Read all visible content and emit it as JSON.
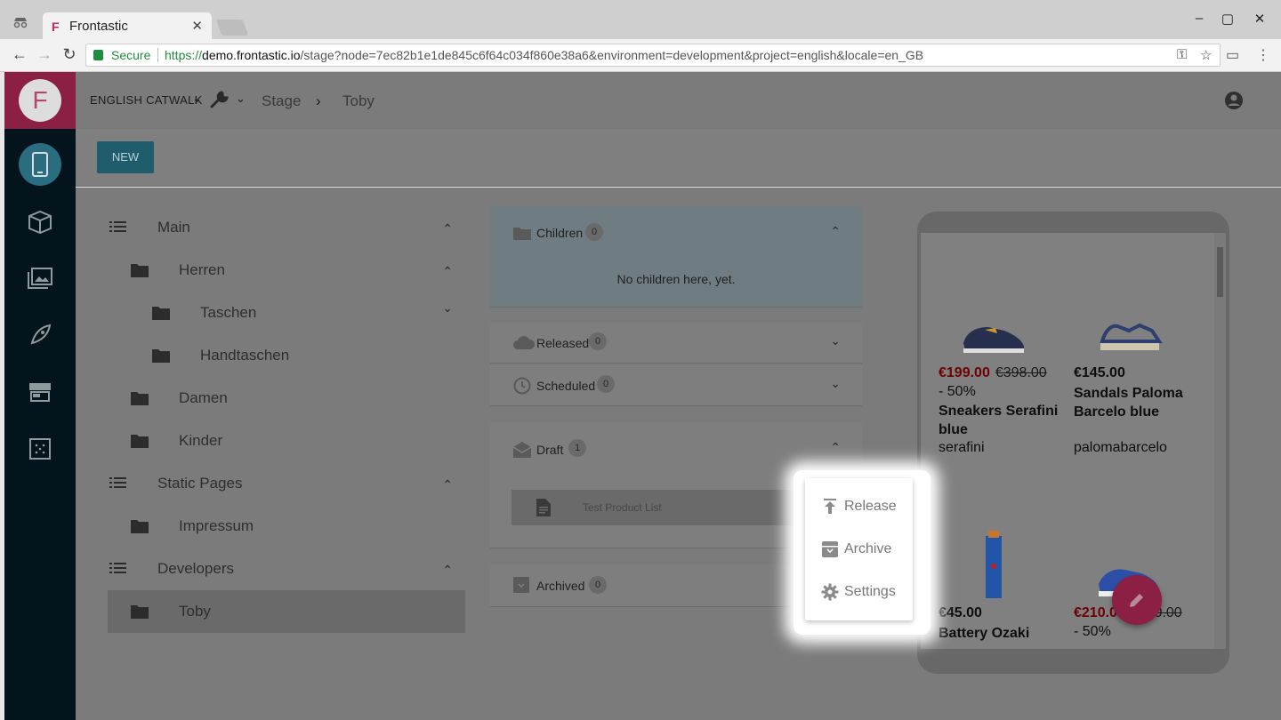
{
  "browser": {
    "tab_title": "Frontastic",
    "secure_label": "Secure",
    "url_scheme": "https://",
    "url_host": "demo.frontastic.io",
    "url_rest": "/stage?node=7ec82b1e1de845c6f64c034f860e38a6&environment=development&project=english&locale=en_GB"
  },
  "header": {
    "project": "ENGLISH CATWALK",
    "breadcrumb": [
      "Stage",
      "Toby"
    ],
    "new_button": "NEW"
  },
  "tree": [
    {
      "label": "Main",
      "type": "list",
      "level": 0,
      "chevron": "up"
    },
    {
      "label": "Herren",
      "type": "folder",
      "level": 1,
      "chevron": "up"
    },
    {
      "label": "Taschen",
      "type": "folder",
      "level": 2,
      "chevron": "down"
    },
    {
      "label": "Handtaschen",
      "type": "folder",
      "level": 2,
      "chevron": ""
    },
    {
      "label": "Damen",
      "type": "folder",
      "level": 1,
      "chevron": ""
    },
    {
      "label": "Kinder",
      "type": "folder",
      "level": 1,
      "chevron": ""
    },
    {
      "label": "Static Pages",
      "type": "list",
      "level": 0,
      "chevron": "up"
    },
    {
      "label": "Impressum",
      "type": "folder",
      "level": 1,
      "chevron": ""
    },
    {
      "label": "Developers",
      "type": "list",
      "level": 0,
      "chevron": "up"
    },
    {
      "label": "Toby",
      "type": "folder",
      "level": 1,
      "chevron": "",
      "selected": true
    }
  ],
  "panels": {
    "children": {
      "title": "Children",
      "count": "0",
      "empty": "No children here, yet."
    },
    "released": {
      "title": "Released",
      "count": "0"
    },
    "scheduled": {
      "title": "Scheduled",
      "count": "0"
    },
    "draft": {
      "title": "Draft",
      "count": "1",
      "item": "Test Product List"
    },
    "archived": {
      "title": "Archived",
      "count": "0"
    }
  },
  "context_menu": {
    "release": "Release",
    "archive": "Archive",
    "settings": "Settings"
  },
  "preview": {
    "products": [
      {
        "price": "€199.00",
        "old_price": "€398.00",
        "discount": "- 50%",
        "name": "Sneakers Serafini blue",
        "brand": "serafini",
        "on_sale": true
      },
      {
        "price": "€145.00",
        "name": "Sandals Paloma Barcelo blue",
        "brand": "palomabarcelo",
        "on_sale": false
      },
      {
        "price": "€45.00",
        "name": "Battery Ozaki",
        "on_sale": false
      },
      {
        "price": "€210.00",
        "old_price": "€420.00",
        "discount": "- 50%",
        "on_sale": true
      }
    ]
  },
  "colors": {
    "brand": "#c6265d",
    "nav_bg": "#04141c",
    "accent": "#2a8fb0",
    "sale": "#d00000"
  }
}
